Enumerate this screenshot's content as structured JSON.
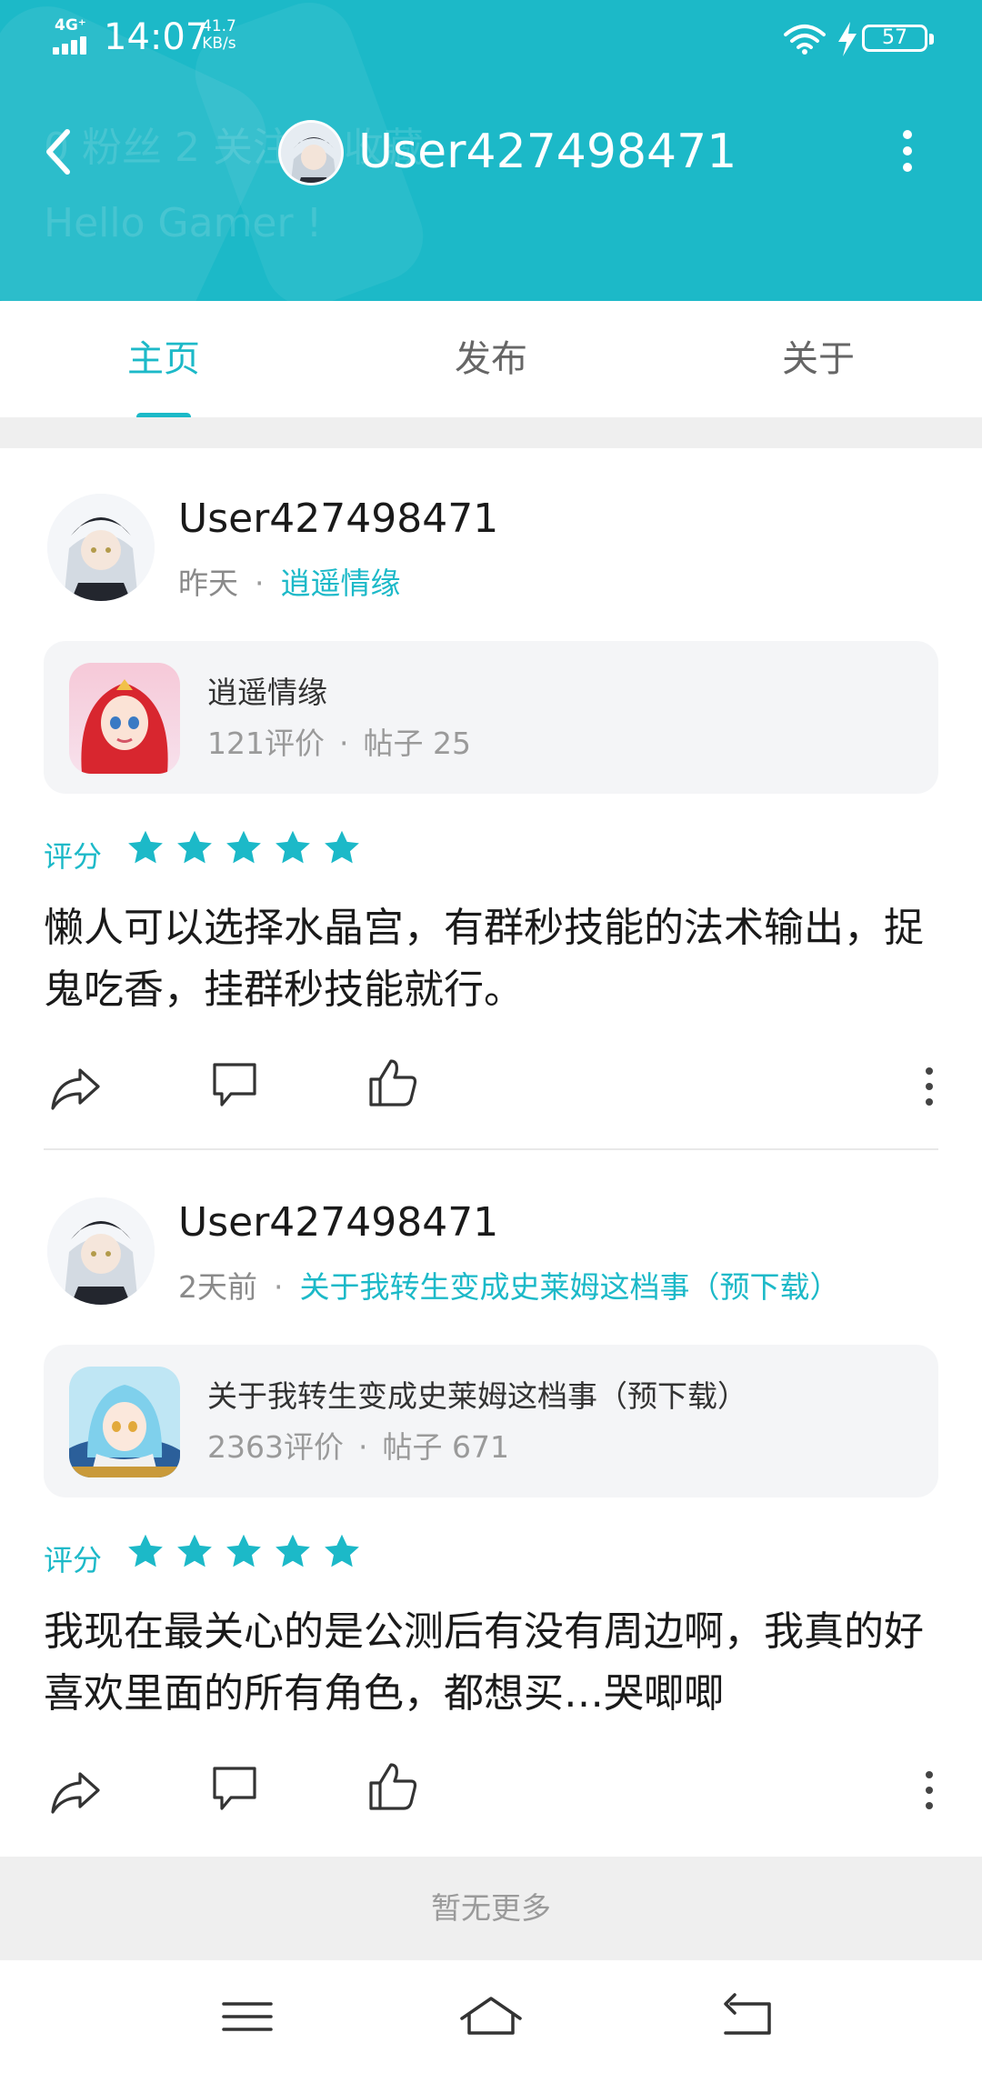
{
  "status_bar": {
    "network": "4G⁺",
    "time": "14:07",
    "speed_value": "41.7",
    "speed_unit": "KB/s",
    "battery": "57"
  },
  "header": {
    "title": "User427498471",
    "ghost_stats": "0 粉丝    2 关注    0 收藏",
    "ghost_bio": "Hello Gamer !"
  },
  "tabs": [
    {
      "label": "主页",
      "active": true
    },
    {
      "label": "发布",
      "active": false
    },
    {
      "label": "关于",
      "active": false
    }
  ],
  "posts": [
    {
      "user": "User427498471",
      "time": "昨天",
      "dot": "·",
      "game_link": "逍遥情缘",
      "game": {
        "name": "逍遥情缘",
        "reviews": "121评价",
        "posts": "帖子 25"
      },
      "rating_label": "评分",
      "rating": 5,
      "text": "懒人可以选择水晶宫，有群秒技能的法术输出，捉鬼吃香，挂群秒技能就行。"
    },
    {
      "user": "User427498471",
      "time": "2天前",
      "dot": "·",
      "game_link": "关于我转生变成史莱姆这档事（预下载）",
      "game": {
        "name": "关于我转生变成史莱姆这档事（预下载）",
        "reviews": "2363评价",
        "posts": "帖子 671"
      },
      "rating_label": "评分",
      "rating": 5,
      "text": "我现在最关心的是公测后有没有周边啊，我真的好喜欢里面的所有角色，都想买…哭唧唧"
    }
  ],
  "footer": {
    "no_more": "暂无更多"
  },
  "colors": {
    "accent": "#1cb9c8",
    "header_bg": "#1cb9c8"
  }
}
